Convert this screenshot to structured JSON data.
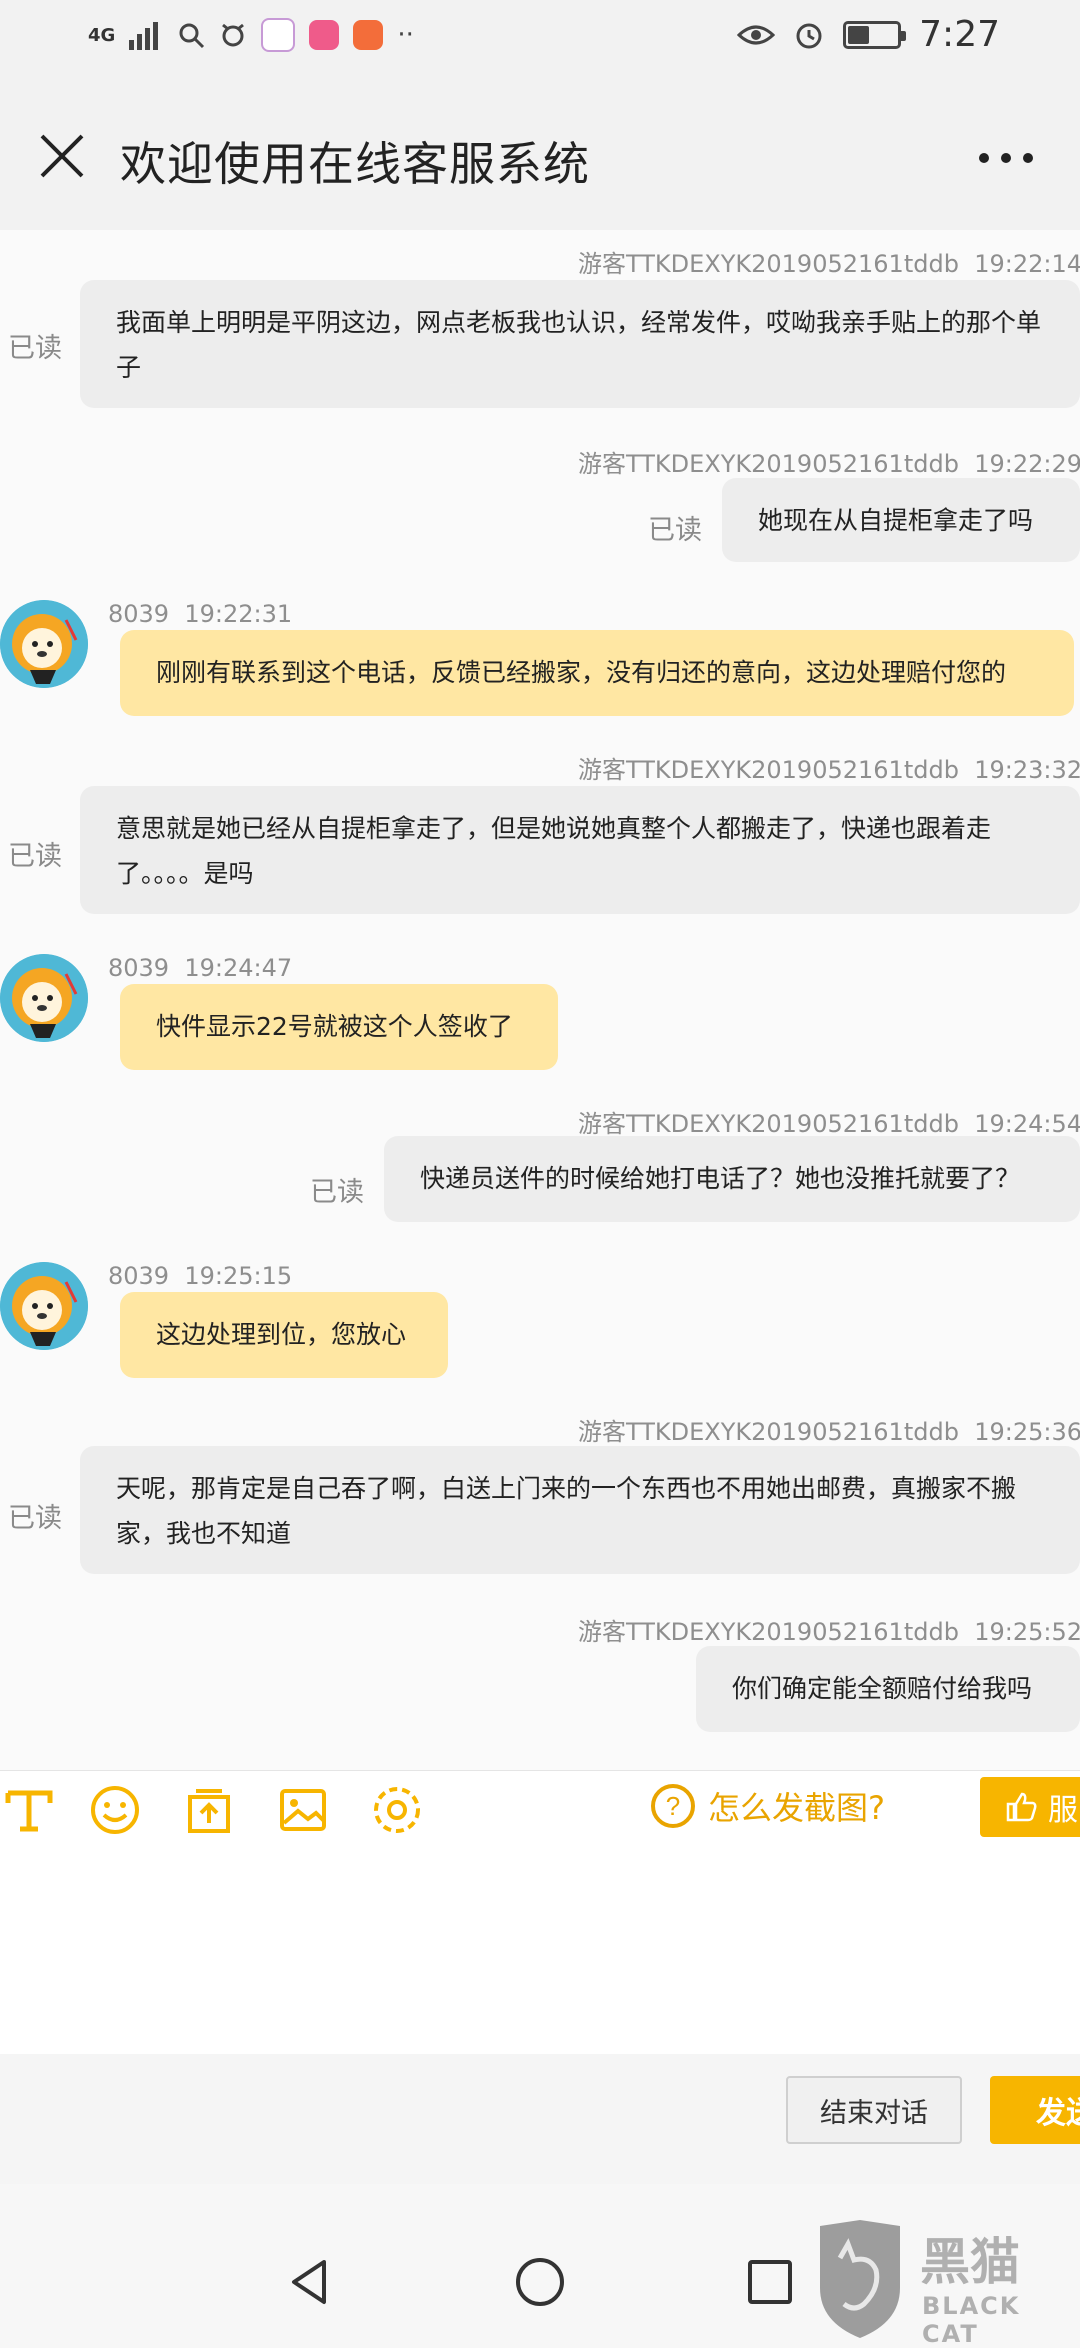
{
  "status_bar": {
    "network": "4G",
    "time": "7:27",
    "battery_level": 0.4
  },
  "header": {
    "title": "欢迎使用在线客服系统"
  },
  "messages": [
    {
      "sender": "游客TTKDEXYK2019052161tddb",
      "time": "19:22:14",
      "text": "我面单上明明是平阴这边，网点老板我也认识，经常发件，哎呦我亲手贴上的那个单子",
      "status": "已读"
    },
    {
      "sender": "游客TTKDEXYK2019052161tddb",
      "time": "19:22:29",
      "text": "她现在从自提柜拿走了吗",
      "status": "已读"
    },
    {
      "sender": "8039",
      "time": "19:22:31",
      "text": "刚刚有联系到这个电话，反馈已经搬家，没有归还的意向，这边处理赔付您的"
    },
    {
      "sender": "游客TTKDEXYK2019052161tddb",
      "time": "19:23:32",
      "text": "意思就是她已经从自提柜拿走了，但是她说她真整个人都搬走了，快递也跟着走了。。。。是吗",
      "status": "已读"
    },
    {
      "sender": "8039",
      "time": "19:24:47",
      "text": "快件显示22号就被这个人签收了"
    },
    {
      "sender": "游客TTKDEXYK2019052161tddb",
      "time": "19:24:54",
      "text": "快递员送件的时候给她打电话了？她也没推托就要了？",
      "status": "已读"
    },
    {
      "sender": "8039",
      "time": "19:25:15",
      "text": "这边处理到位，您放心"
    },
    {
      "sender": "游客TTKDEXYK2019052161tddb",
      "time": "19:25:36",
      "text": "天呢，那肯定是自己吞了啊，白送上门来的一个东西也不用她出邮费，真搬家不搬家，我也不知道",
      "status": "已读"
    },
    {
      "sender": "游客TTKDEXYK2019052161tddb",
      "time": "19:25:52",
      "text": "你们确定能全额赔付给我吗"
    }
  ],
  "toolbar": {
    "help_text": "怎么发截图?",
    "praise_label": "服"
  },
  "actions": {
    "end_label": "结束对话",
    "send_label": "发送"
  },
  "watermark": {
    "brand": "黑猫",
    "sub": "BLACK CAT"
  },
  "colors": {
    "accent": "#f7b500",
    "agent_bubble": "#ffe7a3",
    "user_bubble": "#ededed"
  }
}
